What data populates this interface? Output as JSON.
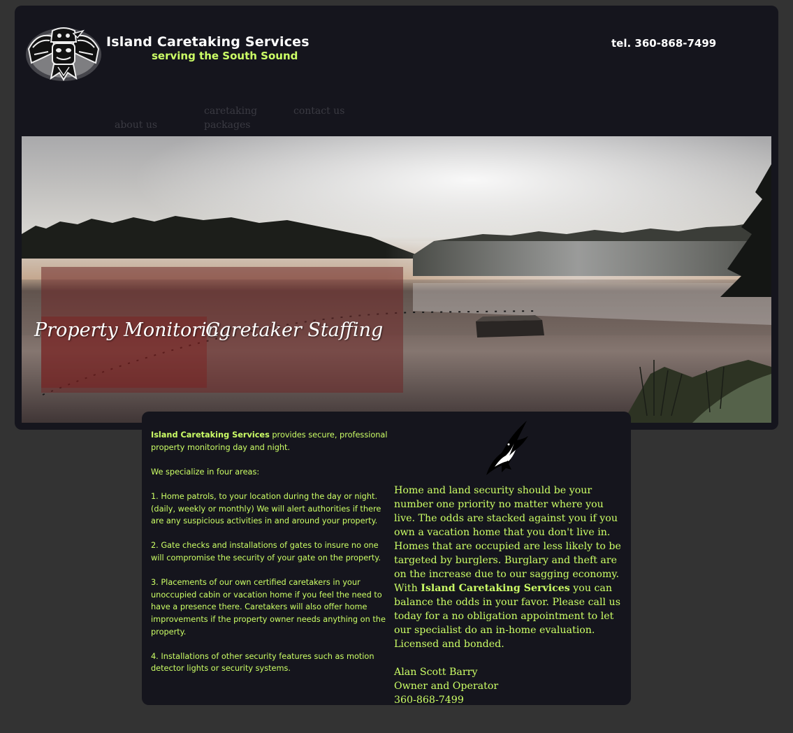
{
  "header": {
    "title": "Island Caretaking Services",
    "tagline": "serving the South Sound",
    "phone": "tel.  360-868-7499",
    "logo_icon": "tribal-thunderbird-logo-icon"
  },
  "nav": {
    "about": "about us",
    "packages": "caretaking packages",
    "contact": "contact us"
  },
  "hero": {
    "link_monitoring": "Property Monitoring",
    "link_staffing": "Caretaker Staffing"
  },
  "content": {
    "intro_strong": "Island Caretaking Services",
    "intro_rest": " provides secure, professional property monitoring day and night.",
    "specialize": "We specialize in four areas:",
    "item1": "1. Home patrols, to your location during the day or night. (daily, weekly or monthly) We will alert authorities if there are any suspicious activities in and around your property.",
    "item2": "2. Gate checks and installations of gates to insure no one will compromise the security of your gate on the property.",
    "item3": "3. Placements of our own certified caretakers in your unoccupied cabin or vacation home if you feel the need to have a presence there. Caretakers will also offer home improvements if the property owner needs anything on the property.",
    "item4": "4. Installations of other security features such as motion detector lights or security systems.",
    "eagle_icon": "eagle-icon",
    "body_part1": "Home and land security should be your number one priority no matter where you live. The odds are stacked against you if you own a vacation home that you don't live in. Homes that are occupied are less likely to be targeted by burglers.  Burglary and theft are on the increase due to our sagging economy. With ",
    "body_strong": "Island Caretaking Services",
    "body_part2": " you can balance the odds in your favor. Please call us today for a no obligation appointment to let our specialist do an in-home evaluation. Licensed and bonded.",
    "owner_name": "Alan Scott Barry",
    "owner_title": "Owner and Operator",
    "owner_phone": "360-868-7499"
  },
  "colors": {
    "page_bg": "#333333",
    "panel_bg": "#15151d",
    "accent": "#ccff66",
    "nav_text": "#3a3a42"
  }
}
